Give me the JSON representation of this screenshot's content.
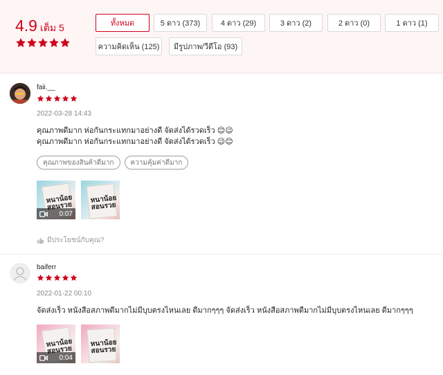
{
  "summary": {
    "score": "4.9",
    "score_suffix": "เต็ม 5",
    "filters": [
      {
        "label": "ทั้งหมด",
        "active": true
      },
      {
        "label": "5 ดาว (373)",
        "active": false
      },
      {
        "label": "4 ดาว (29)",
        "active": false
      },
      {
        "label": "3 ดาว (2)",
        "active": false
      },
      {
        "label": "2 ดาว (0)",
        "active": false
      },
      {
        "label": "1 ดาว (1)",
        "active": false
      },
      {
        "label": "ความคิดเห็น (125)",
        "active": false
      },
      {
        "label": "มีรูปภาพ/วีดีโอ (93)",
        "active": false
      }
    ]
  },
  "reviews": [
    {
      "username": "faii.__",
      "rating": 5,
      "timestamp": "2022-03-28 14:43",
      "comment_lines": [
        "คุณภาพดีมาก ห่อกันกระแทกมาอย่างดี จัดส่งได้รวดเร็ว 😊😉",
        "คุณภาพดีมาก ห่อกันกระแทกมาอย่างดี จัดส่งได้รวดเร็ว 😉😊"
      ],
      "tags": [
        "คุณภาพของสินค้าดีมาก",
        "ความคุ้มค่าดีมาก"
      ],
      "media": [
        {
          "type": "video",
          "duration": "0:07",
          "book_title": "หนาน้อย\nสอนรวย"
        },
        {
          "type": "image",
          "book_title": "หนาน้อย\nสอนรวย"
        }
      ],
      "helpful_label": "มีประโยชน์กับคุณ?"
    },
    {
      "username": "baiferr",
      "rating": 5,
      "timestamp": "2022-01-22 00:10",
      "comment_lines": [
        "จัดส่งเร็ว หนังสือสภาพดีมากไม่มีบุบตรงไหนเลย ดีมากๆๆๆ จัดส่งเร็ว หนังสือสภาพดีมากไม่มีบุบตรงไหนเลย ดีมากๆๆๆ"
      ],
      "media": [
        {
          "type": "video",
          "duration": "0:04",
          "book_title": "หนาน้อย\nสอนรวย"
        },
        {
          "type": "image",
          "book_title": "หนาน้อย\nสอนรวย"
        }
      ]
    }
  ],
  "colors": {
    "accent": "#d0011b",
    "header_bg": "#fef6f5"
  },
  "icons": {
    "star": "star-icon",
    "video": "video-camera-icon",
    "thumbs_up": "thumbs-up-icon",
    "default_avatar": "user-icon"
  }
}
